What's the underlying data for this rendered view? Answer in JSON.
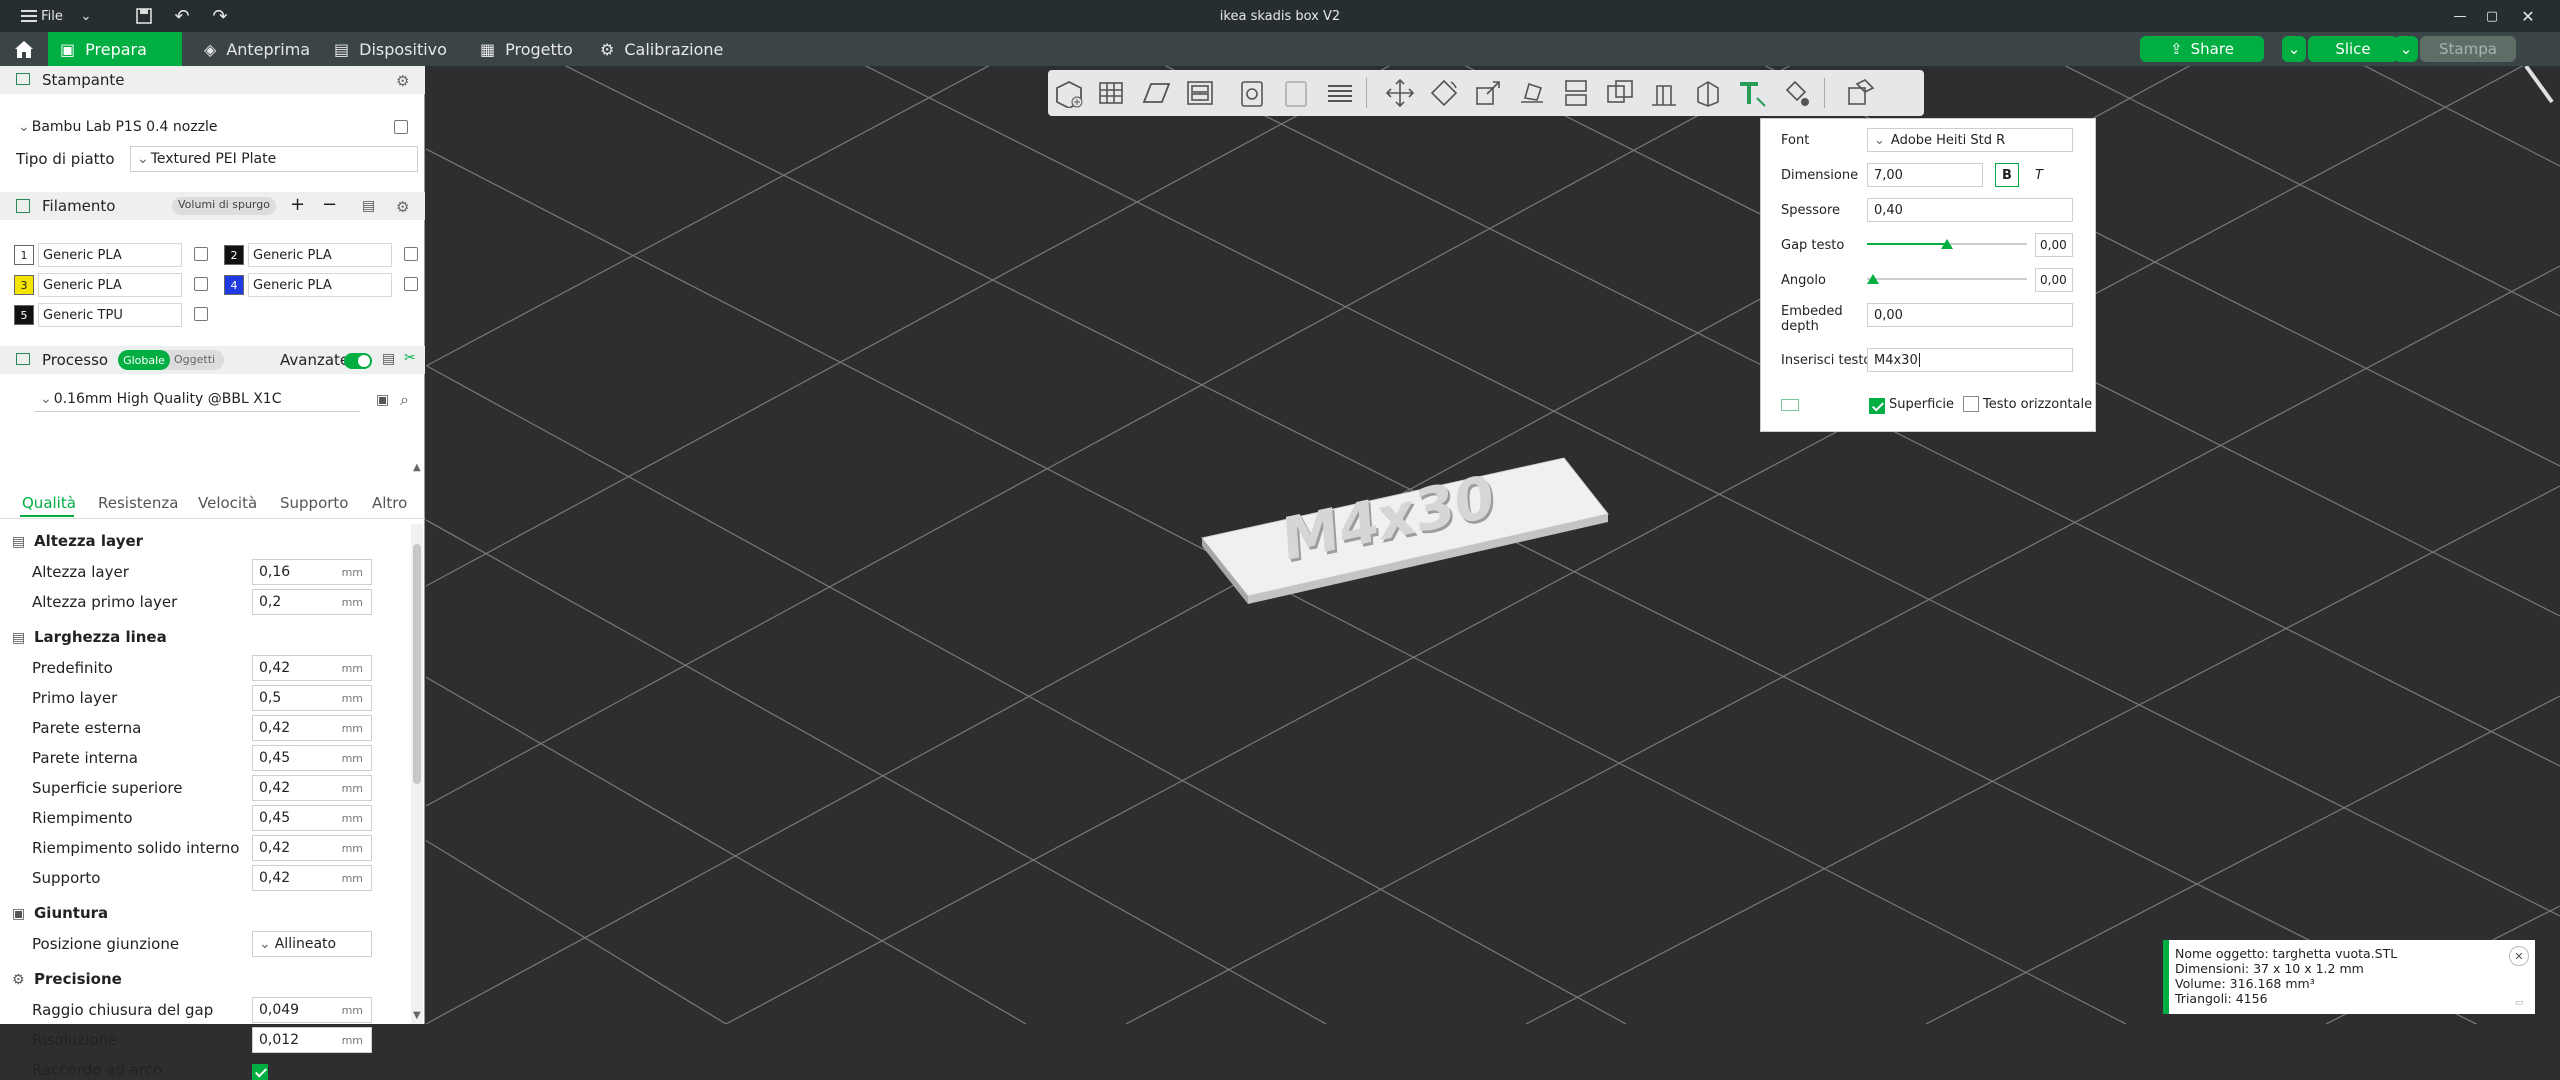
{
  "titlebar": {
    "menu": "File",
    "title": "ikea skadis box V2"
  },
  "menubar": {
    "tabs": [
      "Prepara",
      "Anteprima",
      "Dispositivo",
      "Progetto",
      "Calibrazione"
    ],
    "share": "Share",
    "slice": "Slice",
    "print": "Stampa"
  },
  "printer": {
    "section_title": "Stampante",
    "printer_name": "Bambu Lab P1S 0.4 nozzle",
    "plate_label": "Tipo di piatto",
    "plate_value": "Textured PEI Plate"
  },
  "filament": {
    "section_title": "Filamento",
    "purge_button": "Volumi di spurgo",
    "items": [
      {
        "num": "1",
        "name": "Generic PLA",
        "color": "#ffffff"
      },
      {
        "num": "2",
        "name": "Generic PLA",
        "color": "#111111"
      },
      {
        "num": "3",
        "name": "Generic PLA",
        "color": "#f4e400"
      },
      {
        "num": "4",
        "name": "Generic PLA",
        "color": "#1e3ae0"
      },
      {
        "num": "5",
        "name": "Generic TPU",
        "color": "#111111"
      }
    ]
  },
  "process": {
    "section_title": "Processo",
    "toggle_global": "Globale",
    "toggle_objects": "Oggetti",
    "advanced_label": "Avanzate",
    "preset": "0.16mm High Quality @BBL X1C",
    "tabs": [
      "Qualità",
      "Resistenza",
      "Velocità",
      "Supporto",
      "Altro"
    ],
    "groups": {
      "layer_height": "Altezza layer",
      "line_width": "Larghezza linea",
      "seam": "Giuntura",
      "precision": "Precisione"
    },
    "settings": {
      "layer_height": {
        "label": "Altezza layer",
        "value": "0,16",
        "unit": "mm"
      },
      "first_layer_height": {
        "label": "Altezza primo layer",
        "value": "0,2",
        "unit": "mm"
      },
      "default_width": {
        "label": "Predefinito",
        "value": "0,42",
        "unit": "mm"
      },
      "first_layer_width": {
        "label": "Primo layer",
        "value": "0,5",
        "unit": "mm"
      },
      "outer_wall": {
        "label": "Parete esterna",
        "value": "0,42",
        "unit": "mm"
      },
      "inner_wall": {
        "label": "Parete interna",
        "value": "0,45",
        "unit": "mm"
      },
      "top_surface": {
        "label": "Superficie superiore",
        "value": "0,42",
        "unit": "mm"
      },
      "infill": {
        "label": "Riempimento",
        "value": "0,45",
        "unit": "mm"
      },
      "internal_solid_infill": {
        "label": "Riempimento solido interno",
        "value": "0,42",
        "unit": "mm"
      },
      "support": {
        "label": "Supporto",
        "value": "0,42",
        "unit": "mm"
      },
      "seam_position": {
        "label": "Posizione giunzione",
        "value": "Allineato"
      },
      "gap_closing": {
        "label": "Raggio chiusura del gap",
        "value": "0,049",
        "unit": "mm"
      },
      "resolution": {
        "label": "Risoluzione",
        "value": "0,012",
        "unit": "mm"
      },
      "arc_fitting": {
        "label": "Raccordo ad arco"
      }
    }
  },
  "text_panel": {
    "font_label": "Font",
    "font_value": "Adobe Heiti Std R",
    "size_label": "Dimensione",
    "size_value": "7,00",
    "bold": "B",
    "italic": "T",
    "thickness_label": "Spessore",
    "thickness_value": "0,40",
    "gap_label": "Gap testo",
    "gap_value": "0,00",
    "angle_label": "Angolo",
    "angle_value": "0,00",
    "embedded_label": "Embeded depth",
    "embedded_value": "0,00",
    "text_label": "Inserisci testo",
    "text_value": "M4x30",
    "surface_label": "Superficie",
    "horizontal_label": "Testo orizzontale"
  },
  "object_text": "M4x30",
  "info": {
    "name": "Nome oggetto: targhetta vuota.STL",
    "dims": "Dimensioni: 37 x 10 x 1.2 mm",
    "volume": "Volume: 316.168 mm³",
    "triangles": "Triangoli: 4156"
  },
  "colors": {
    "accent": "#00ae42",
    "titlebar": "#262e30",
    "menubar": "#3b4446",
    "viewport": "#2e2e30"
  }
}
